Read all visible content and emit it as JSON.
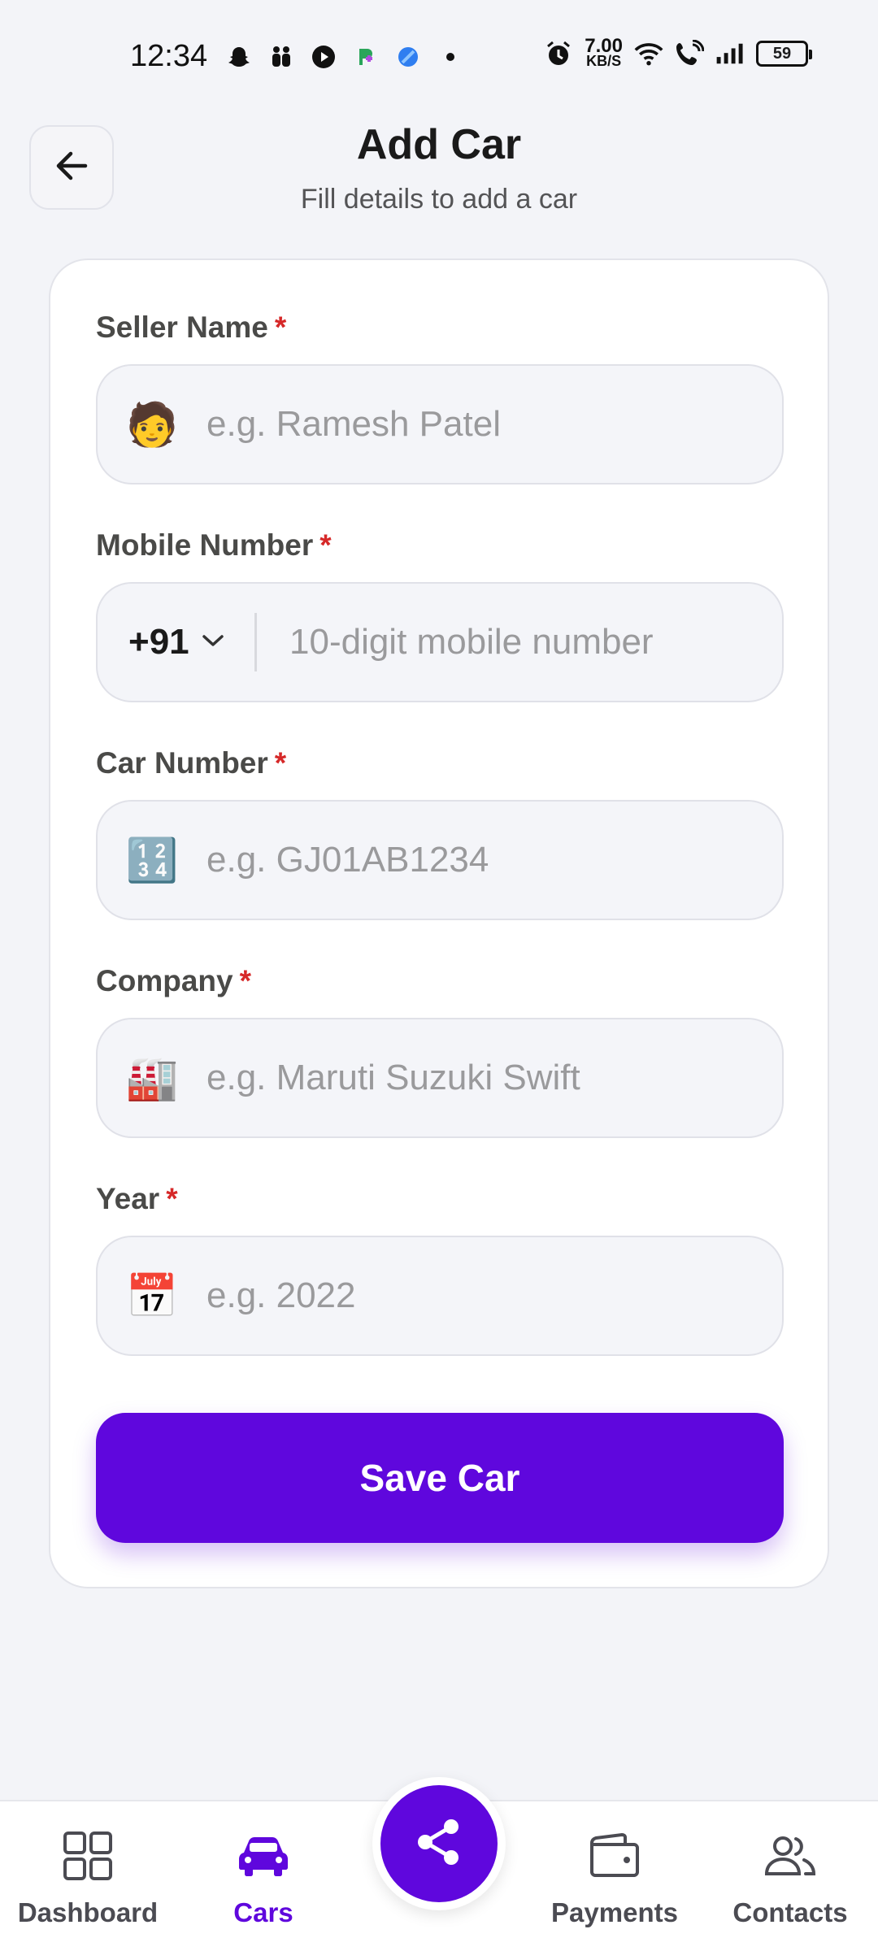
{
  "status_bar": {
    "time": "12:34",
    "net_speed_value": "7.00",
    "net_speed_unit": "KB/S",
    "battery": "59",
    "icons_left": [
      "snapchat-icon",
      "family-icon",
      "play-icon",
      "app-icon",
      "browser-icon",
      "dot-icon"
    ],
    "icons_right": [
      "alarm-icon",
      "wifi-icon",
      "wifi-call-icon",
      "signal-icon",
      "battery-icon"
    ]
  },
  "header": {
    "title": "Add Car",
    "subtitle": "Fill details to add a car",
    "back_icon": "arrow-left-icon"
  },
  "form": {
    "fields": [
      {
        "label": "Seller Name",
        "required_mark": "*",
        "emoji": "🧑",
        "placeholder": "e.g. Ramesh Patel"
      },
      {
        "label": "Mobile Number",
        "required_mark": "*",
        "country_code": "+91",
        "placeholder": "10-digit mobile number"
      },
      {
        "label": "Car Number",
        "required_mark": "*",
        "emoji": "🔢",
        "placeholder": "e.g. GJ01AB1234"
      },
      {
        "label": "Company",
        "required_mark": "*",
        "emoji": "🏭",
        "placeholder": "e.g. Maruti Suzuki Swift"
      },
      {
        "label": "Year",
        "required_mark": "*",
        "emoji": "📅",
        "placeholder": "e.g. 2022"
      }
    ],
    "save_label": "Save Car"
  },
  "bottom_nav": {
    "items": [
      {
        "label": "Dashboard",
        "icon": "grid-icon",
        "active": false
      },
      {
        "label": "Cars",
        "icon": "car-icon",
        "active": true
      },
      {
        "label": "Payments",
        "icon": "wallet-icon",
        "active": false
      },
      {
        "label": "Contacts",
        "icon": "contacts-icon",
        "active": false
      }
    ],
    "fab_icon": "share-icon"
  },
  "colors": {
    "accent": "#5f07dd",
    "background": "#f3f4f8",
    "required": "#d62828"
  }
}
